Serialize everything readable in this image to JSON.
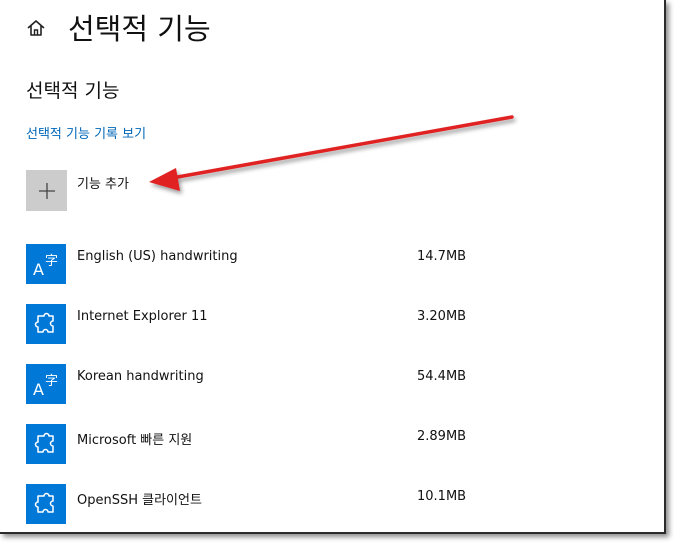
{
  "header": {
    "title": "선택적 기능",
    "home_icon": "home-icon"
  },
  "section": {
    "title": "선택적 기능"
  },
  "history_link": {
    "label": "선택적 기능 기록 보기",
    "color": "#0067b8"
  },
  "add_feature": {
    "label": "기능 추가",
    "icon": "plus-icon"
  },
  "features": [
    {
      "name": "English (US) handwriting",
      "size": "14.7MB",
      "icon": "language-icon"
    },
    {
      "name": "Internet Explorer 11",
      "size": "3.20MB",
      "icon": "puzzle-icon"
    },
    {
      "name": "Korean handwriting",
      "size": "54.4MB",
      "icon": "language-icon"
    },
    {
      "name": "Microsoft 빠른 지원",
      "size": "2.89MB",
      "icon": "puzzle-icon"
    },
    {
      "name": "OpenSSH 클라이언트",
      "size": "10.1MB",
      "icon": "puzzle-icon"
    }
  ],
  "colors": {
    "accent": "#0078d7",
    "annotation_arrow": "#e02020",
    "add_button_bg": "#cccccc"
  }
}
